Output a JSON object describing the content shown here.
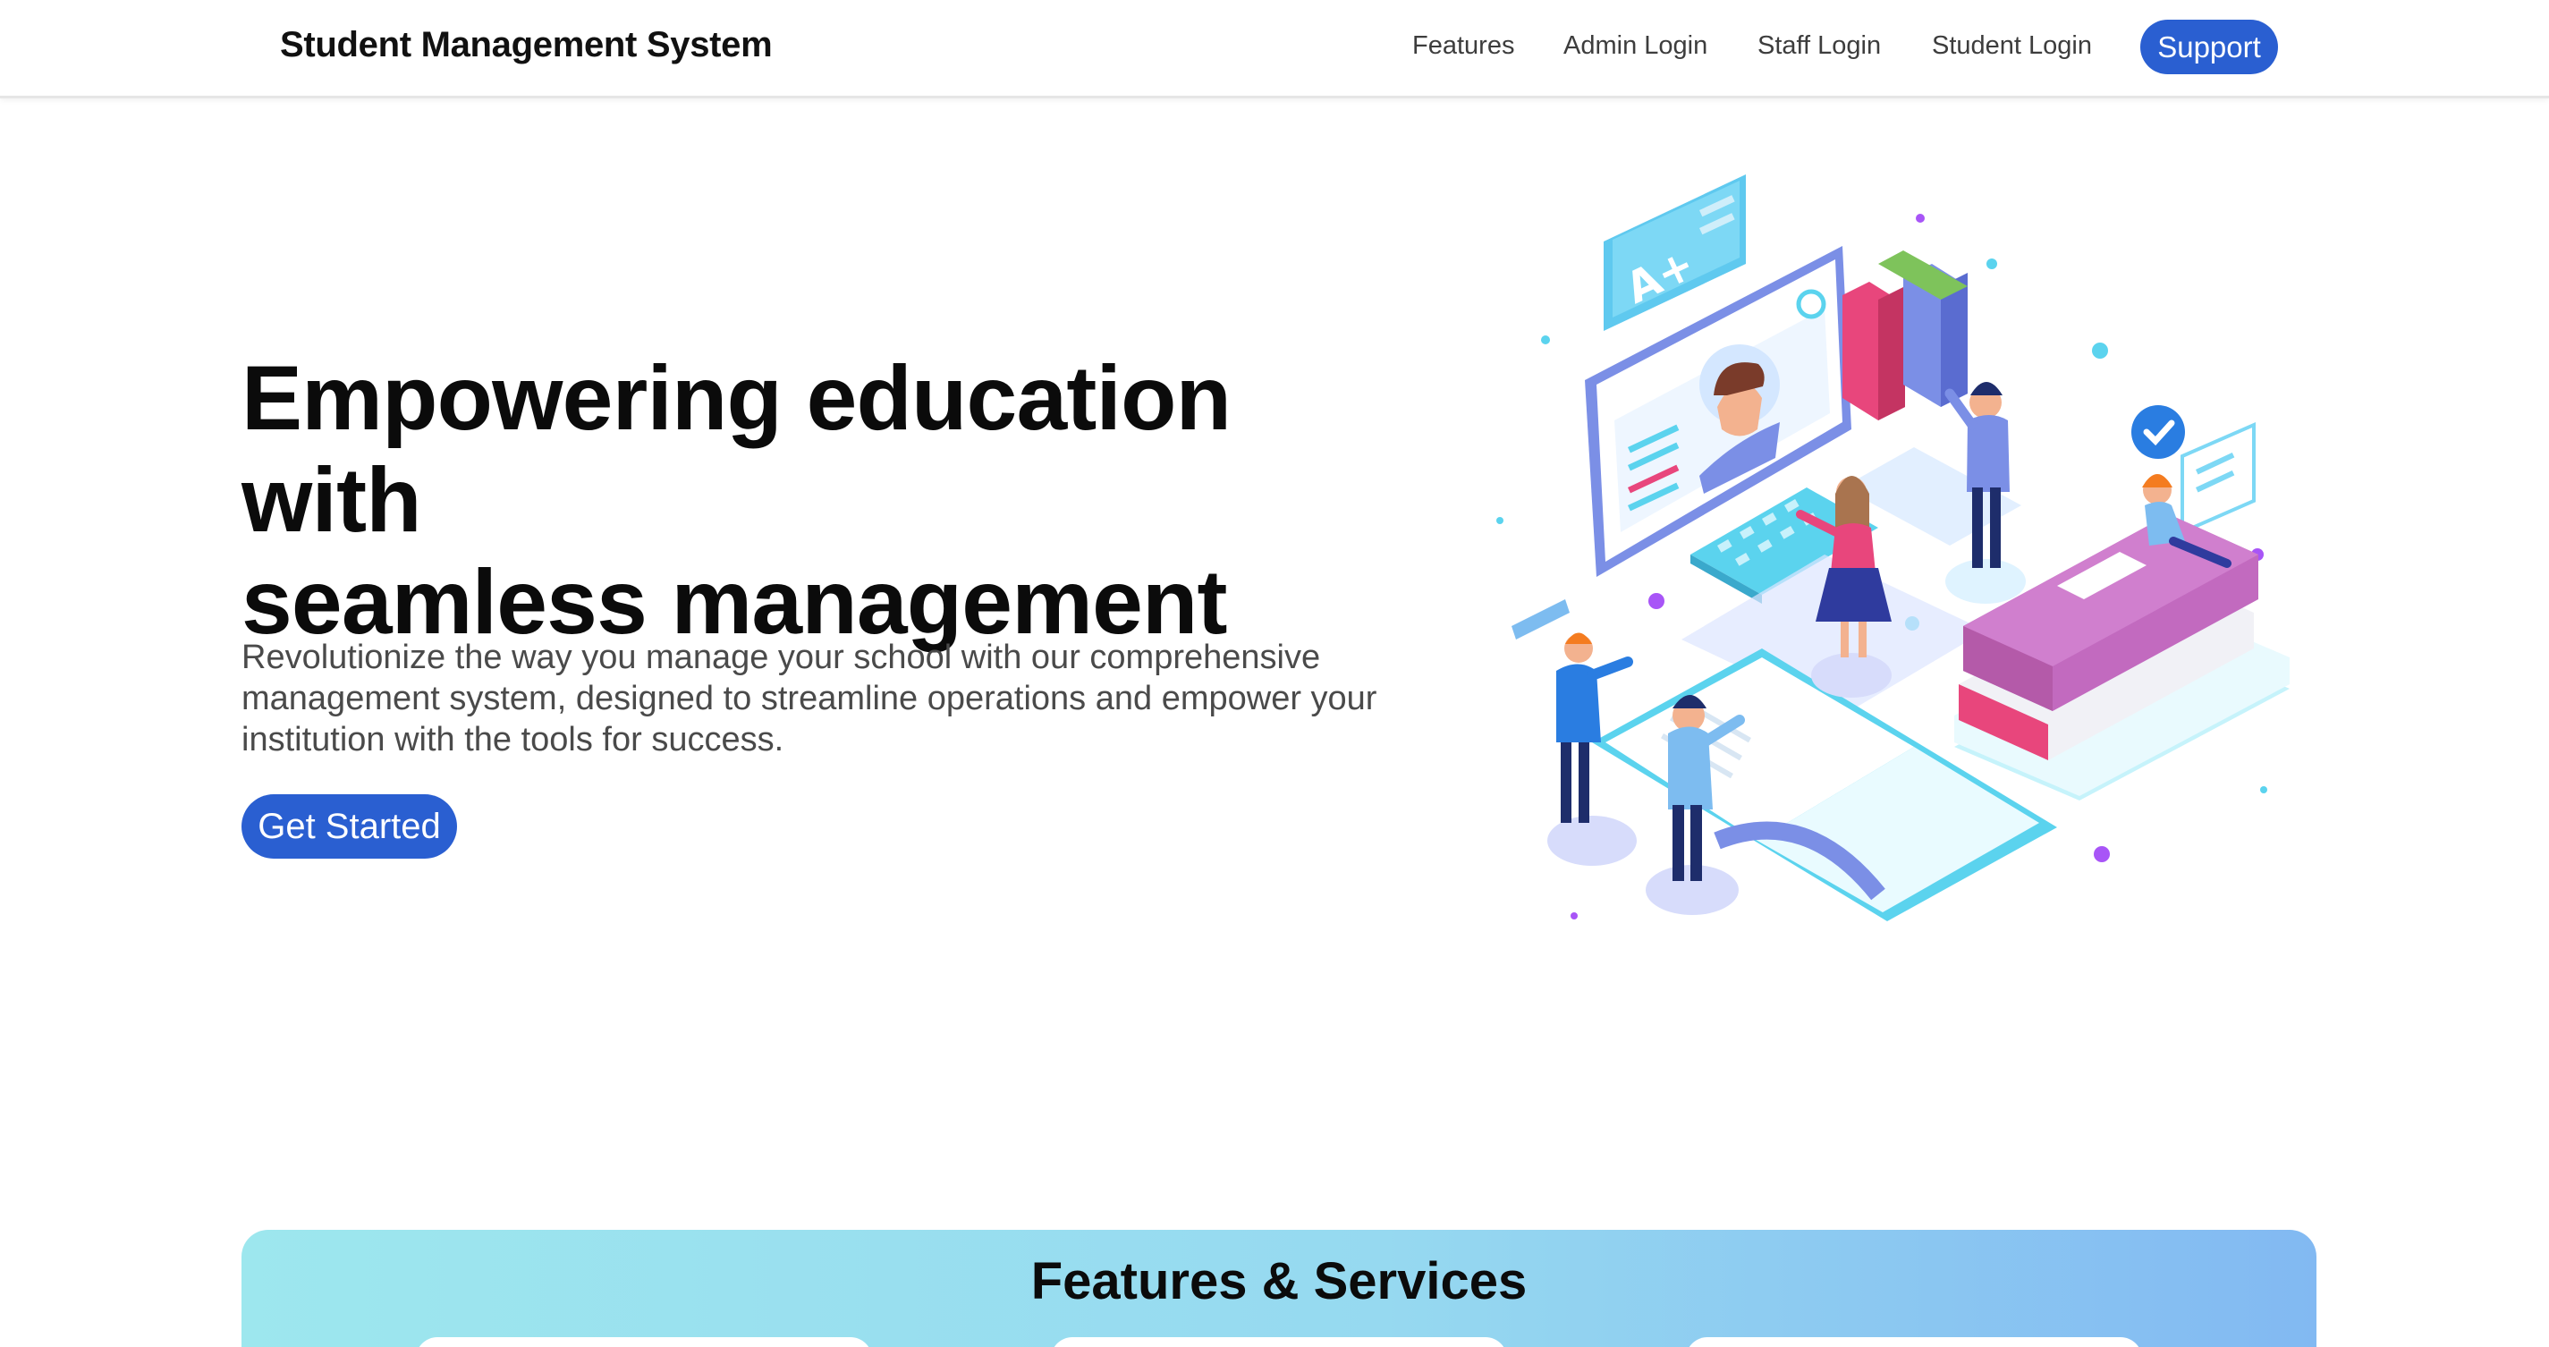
{
  "nav": {
    "brand": "Student Management System",
    "links": [
      "Features",
      "Admin Login",
      "Staff Login",
      "Student Login"
    ],
    "support_label": "Support"
  },
  "hero": {
    "title_line1": "Empowering education with",
    "title_line2": "seamless management",
    "description": "Revolutionize the way you manage your school with our comprehensive management system, designed to streamline operations and empower your institution with the tools for success.",
    "cta_label": "Get Started",
    "illustration": "education-isometric-illustration"
  },
  "features": {
    "title": "Features & Services"
  },
  "colors": {
    "accent": "#2a5fd1",
    "features_gradient_start": "#9de7ee",
    "features_gradient_end": "#82b9f2"
  }
}
